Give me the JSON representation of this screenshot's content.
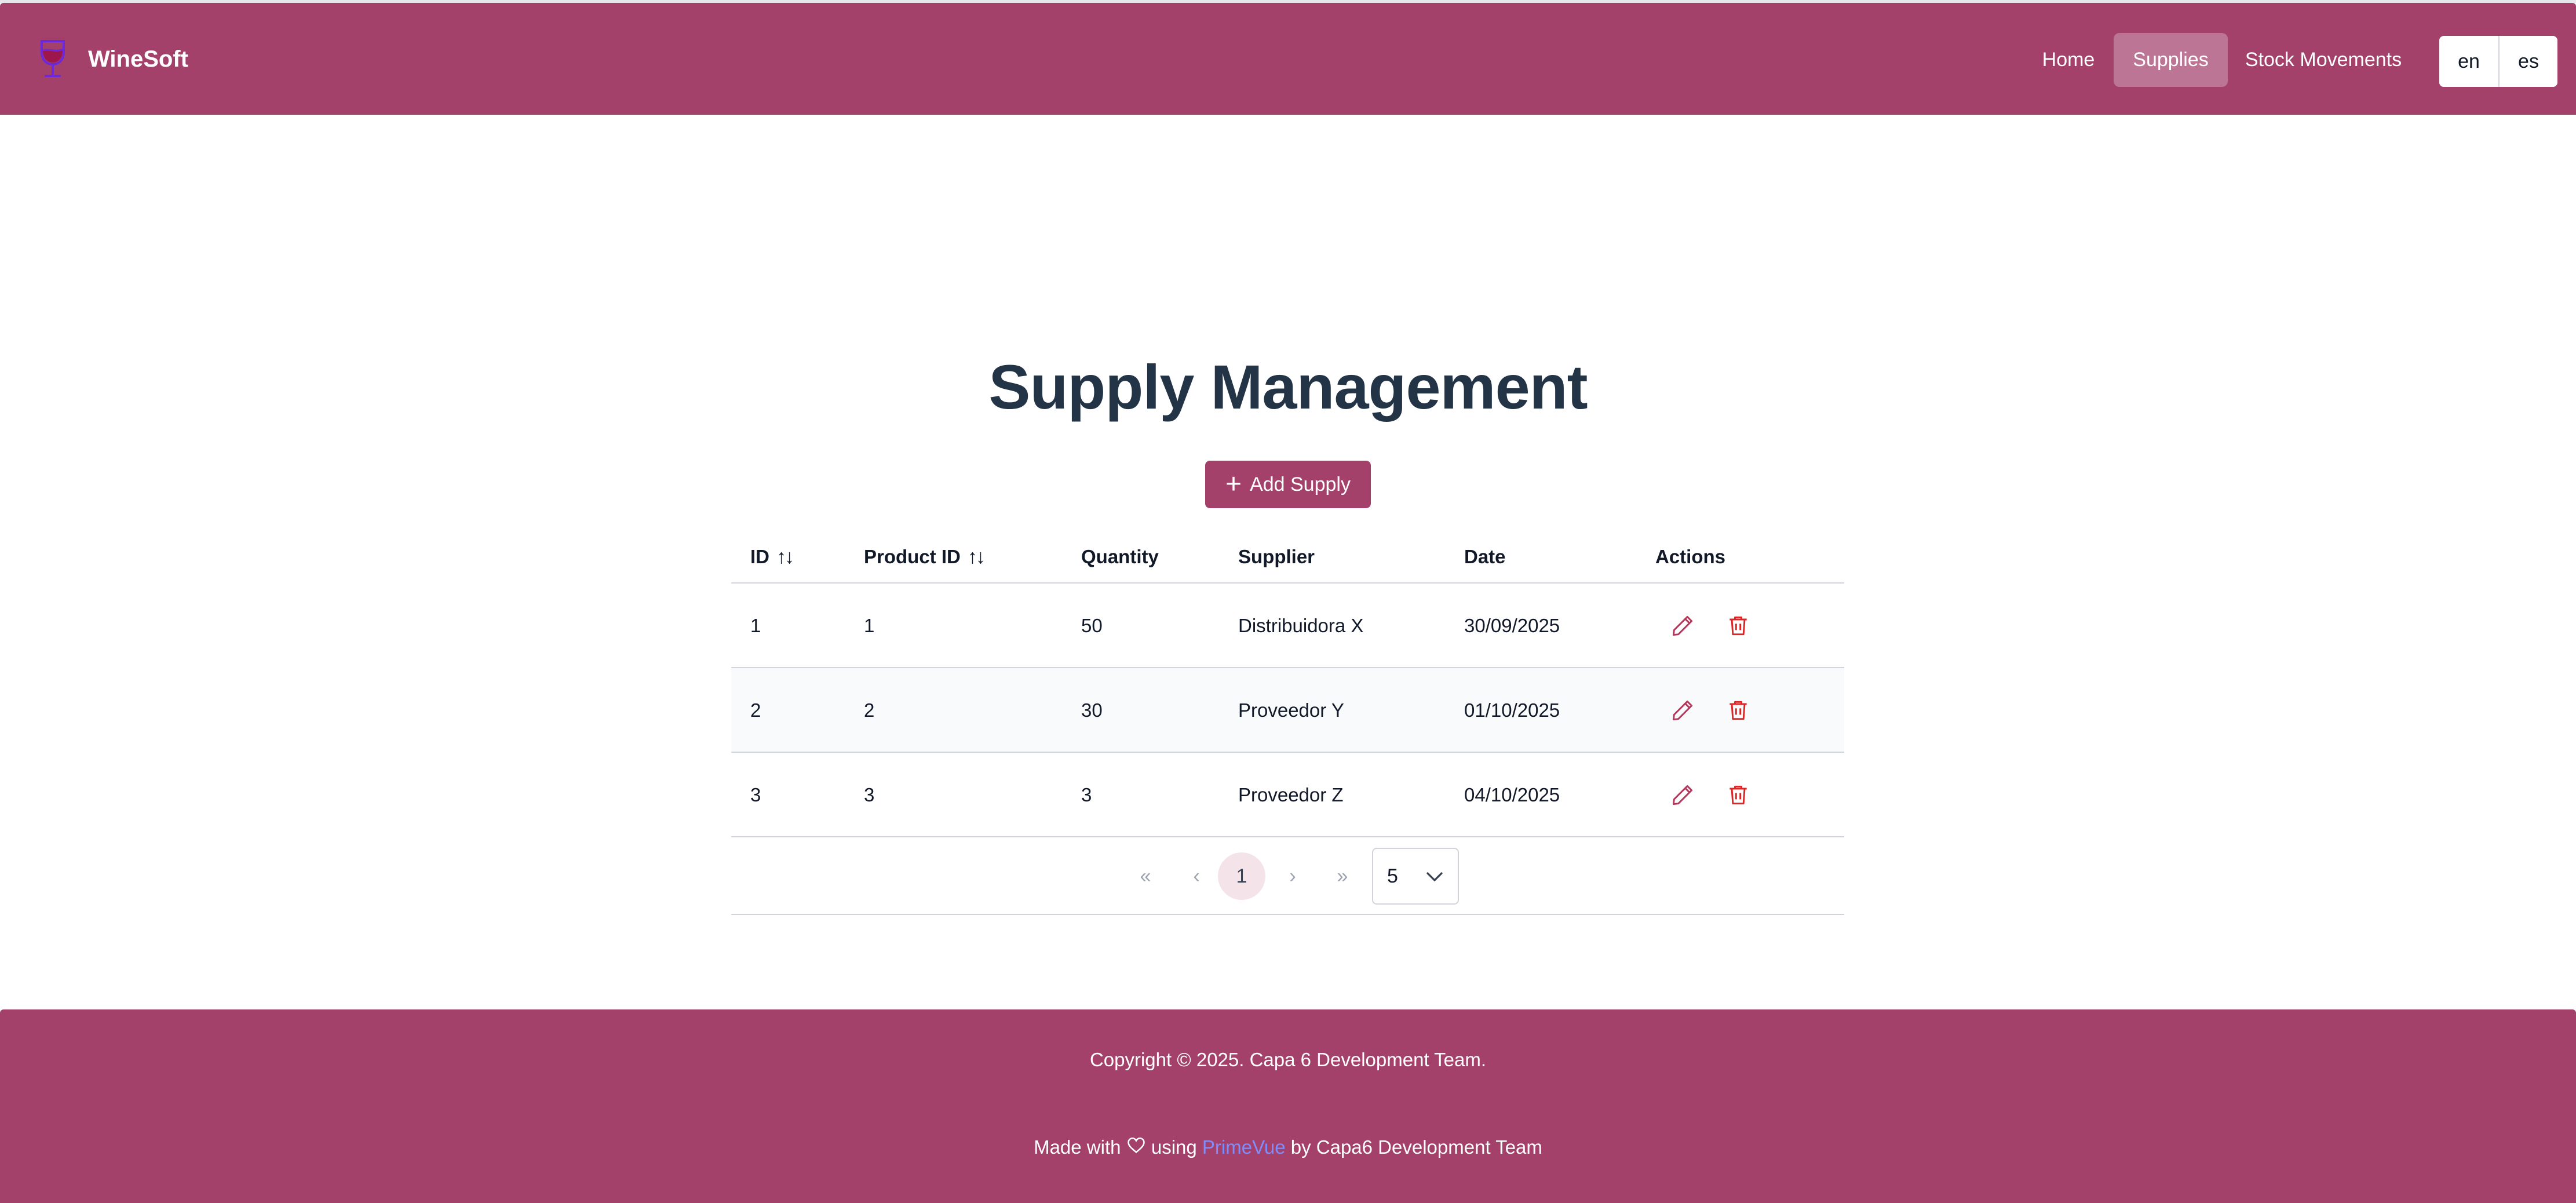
{
  "app": {
    "name": "WineSoft"
  },
  "nav": {
    "items": [
      {
        "label": "Home",
        "active": false
      },
      {
        "label": "Supplies",
        "active": true
      },
      {
        "label": "Stock Movements",
        "active": false
      }
    ],
    "languages": [
      "en",
      "es"
    ]
  },
  "main": {
    "title": "Supply Management",
    "add_button_label": "Add Supply"
  },
  "table": {
    "columns": [
      "ID",
      "Product ID",
      "Quantity",
      "Supplier",
      "Date",
      "Actions"
    ],
    "rows": [
      {
        "id": "1",
        "product_id": "1",
        "quantity": "50",
        "supplier": "Distribuidora X",
        "date": "30/09/2025"
      },
      {
        "id": "2",
        "product_id": "2",
        "quantity": "30",
        "supplier": "Proveedor Y",
        "date": "01/10/2025"
      },
      {
        "id": "3",
        "product_id": "3",
        "quantity": "3",
        "supplier": "Proveedor Z",
        "date": "04/10/2025"
      }
    ]
  },
  "pagination": {
    "first": "«",
    "prev": "‹",
    "current_page": "1",
    "next": "›",
    "last": "»",
    "rows_per_page": "5"
  },
  "footer": {
    "copyright": "Copyright © 2025. Capa 6 Development Team.",
    "made_prefix": "Made with",
    "made_using": "using",
    "made_link": "PrimeVue",
    "made_suffix": "by Capa6 Development Team"
  },
  "colors": {
    "brand": "#a3416b",
    "action_icon": "#b4365a",
    "link": "#818cf8"
  }
}
